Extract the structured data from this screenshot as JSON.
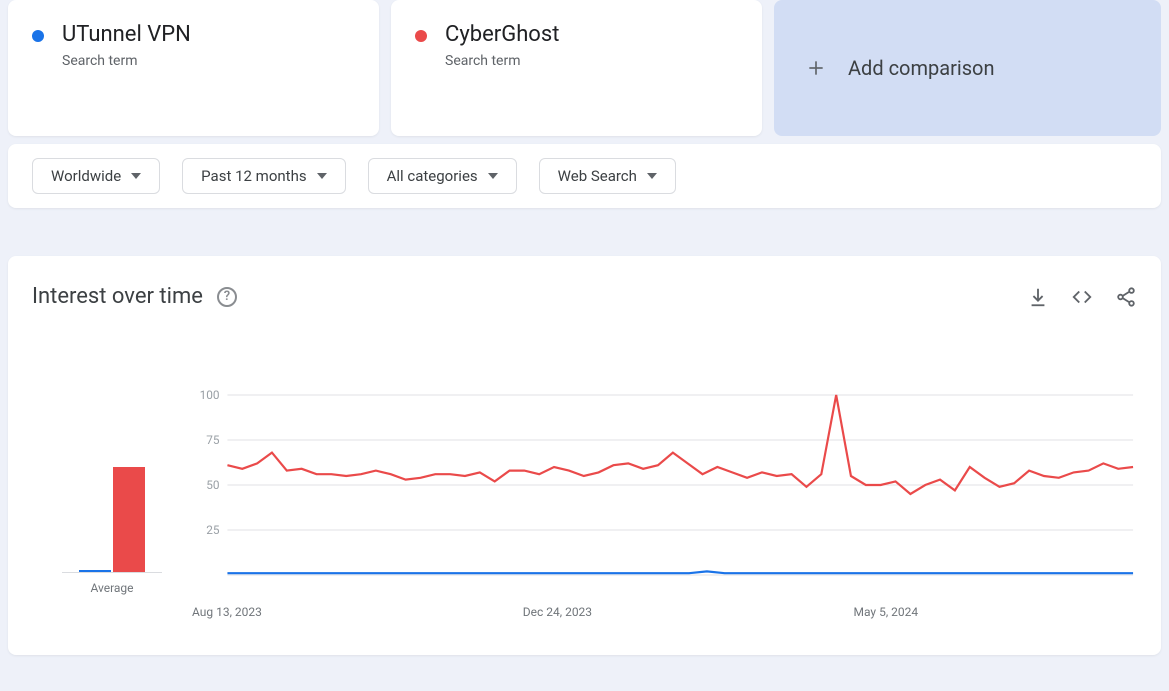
{
  "terms": [
    {
      "name": "UTunnel VPN",
      "sub": "Search term",
      "color": "#1a73e8"
    },
    {
      "name": "CyberGhost",
      "sub": "Search term",
      "color": "#ea4a4a"
    }
  ],
  "add_comparison_label": "Add comparison",
  "filters": {
    "region": "Worldwide",
    "timeframe": "Past 12 months",
    "category": "All categories",
    "search_type": "Web Search"
  },
  "chart": {
    "title": "Interest over time",
    "average_label": "Average",
    "help_tooltip": "?"
  },
  "chart_data": {
    "type": "line",
    "ylabel": "",
    "xlabel": "",
    "ylim": [
      0,
      100
    ],
    "y_ticks": [
      25,
      50,
      75,
      100
    ],
    "x_tick_labels": [
      "Aug 13, 2023",
      "Dec 24, 2023",
      "May 5, 2024"
    ],
    "series": [
      {
        "name": "UTunnel VPN",
        "color": "#1a73e8",
        "average": 1,
        "values": [
          1,
          1,
          1,
          1,
          1,
          1,
          1,
          1,
          1,
          1,
          1,
          1,
          1,
          1,
          1,
          1,
          1,
          1,
          1,
          1,
          1,
          1,
          1,
          1,
          1,
          1,
          1,
          2,
          1,
          1,
          1,
          1,
          1,
          1,
          1,
          1,
          1,
          1,
          1,
          1,
          1,
          1,
          1,
          1,
          1,
          1,
          1,
          1,
          1,
          1,
          1,
          1
        ]
      },
      {
        "name": "CyberGhost",
        "color": "#ea4a4a",
        "average": 57,
        "values": [
          61,
          59,
          62,
          68,
          58,
          59,
          56,
          56,
          55,
          56,
          58,
          56,
          53,
          54,
          56,
          56,
          55,
          57,
          52,
          58,
          58,
          56,
          60,
          58,
          55,
          57,
          61,
          62,
          59,
          61,
          68,
          62,
          56,
          60,
          57,
          54,
          57,
          55,
          56,
          49,
          56,
          100,
          55,
          50,
          50,
          52,
          45,
          50,
          53,
          47,
          60,
          54,
          49,
          51,
          58,
          55,
          54,
          57,
          58,
          62,
          59,
          60
        ]
      }
    ]
  }
}
